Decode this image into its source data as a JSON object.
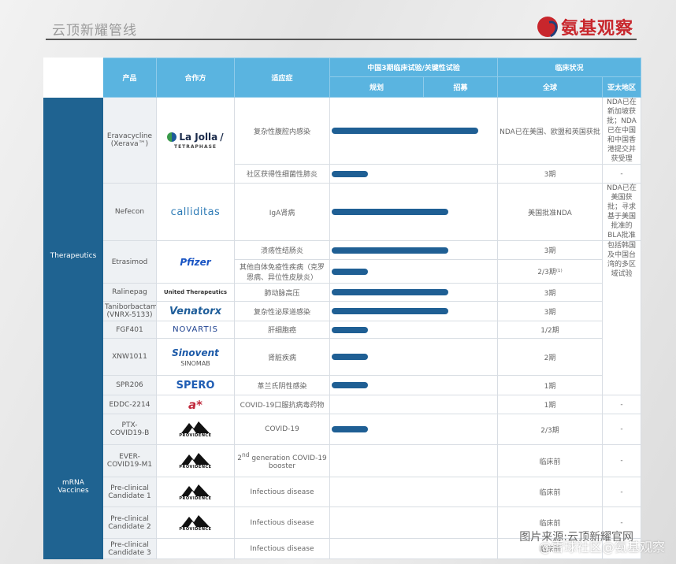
{
  "header": {
    "title": "云顶新耀管线",
    "brand_name": "氨基观察",
    "brand_color": "#c8262c"
  },
  "table": {
    "head": {
      "product": "产品",
      "partner": "合作方",
      "indication": "适应症",
      "china_trials": "中国3期临床试验/关键性试验",
      "planned": "规划",
      "enrolling": "招募",
      "clinical_status": "临床状况",
      "global": "全球",
      "apac": "亚太地区"
    },
    "categories": {
      "therapeutics": "Therapeutics",
      "mrna": "mRNA Vaccines"
    },
    "rows": [
      {
        "product": "Eravacycline (Xerava™)",
        "partner": "La Jolla / TETRAPHASE",
        "indication": "复杂性腹腔内感染",
        "global": "NDA已在美国、欧盟和英国获批",
        "apac": "NDA已在新加坡获批；NDA已在中国和中国香港提交并获受理"
      },
      {
        "indication": "社区获得性细菌性肺炎",
        "global": "3期",
        "apac": "-"
      },
      {
        "product": "Nefecon",
        "partner": "calliditas",
        "indication": "IgA肾病",
        "global": "美国批准NDA",
        "apac": "NDA已在美国获批；寻求基于美国批准的BLA批准"
      },
      {
        "product": "Etrasimod",
        "partner": "Pfizer",
        "indication": "溃疡性结肠炎",
        "global": "3期",
        "apac": "包括韩国及中国台湾的多区域试验"
      },
      {
        "indication": "其他自体免疫性疾病（克罗恩病、异位性皮肤炎）",
        "global": "2/3期⁽¹⁾",
        "apac": ""
      },
      {
        "product": "Ralinepag",
        "partner": "United Therapeutics",
        "indication": "肺动脉高压",
        "global": "3期",
        "apac": ""
      },
      {
        "product": "Taniborbactam (VNRX-5133)",
        "partner": "Venatorx",
        "indication": "复杂性泌尿道感染",
        "global": "3期",
        "apac": ""
      },
      {
        "product": "FGF401",
        "partner": "NOVARTIS",
        "indication": "肝细胞癌",
        "global": "1/2期",
        "apac": ""
      },
      {
        "product": "XNW1011",
        "partner": "Sinovent / SINOMAB",
        "indication": "肾脏疾病",
        "global": "2期",
        "apac": ""
      },
      {
        "product": "SPR206",
        "partner": "SPERO",
        "indication": "革兰氏阴性感染",
        "global": "1期",
        "apac": ""
      },
      {
        "product": "EDDC-2214",
        "partner": "A*",
        "indication": "COVID-19口服抗病毒药物",
        "global": "1期",
        "apac": "-"
      },
      {
        "product": "PTX-COVID19-B",
        "partner": "PROVIDENCE",
        "indication": "COVID-19",
        "global": "2/3期",
        "apac": "-"
      },
      {
        "product": "EVER-COVID19-M1",
        "partner": "PROVIDENCE",
        "indication_pre": "2",
        "indication_sup": "nd",
        "indication_post": " generation COVID-19 booster",
        "global": "临床前",
        "apac": "-"
      },
      {
        "product": "Pre-clinical Candidate 1",
        "partner": "PROVIDENCE",
        "indication": "Infectious disease",
        "global": "临床前",
        "apac": "-"
      },
      {
        "product": "Pre-clinical Candidate 2",
        "partner": "PROVIDENCE",
        "indication": "Infectious disease",
        "global": "临床前",
        "apac": "-"
      },
      {
        "product": "Pre-clinical Candidate 3",
        "indication": "Infectious disease",
        "global": "临床前",
        "apac": "-"
      }
    ],
    "logo_text": {
      "lajolla": "La Jolla",
      "tetraphase": "TETRAPHASE",
      "calliditas": "calliditas",
      "pfizer": "Pfizer",
      "united": "United Therapeutics",
      "venatorx": "Venatorx",
      "novartis": "NOVARTIS",
      "sinovent": "Sinovent",
      "sinomab": "SINOMAB",
      "spero": "SPERO",
      "astar": "a*",
      "providence": "PROVIDENCE"
    },
    "bar_color": "#1f5f94"
  },
  "footer": {
    "source": "图片来源:云顶新耀官网",
    "watermark": "@雪球社区@氨基观察"
  }
}
